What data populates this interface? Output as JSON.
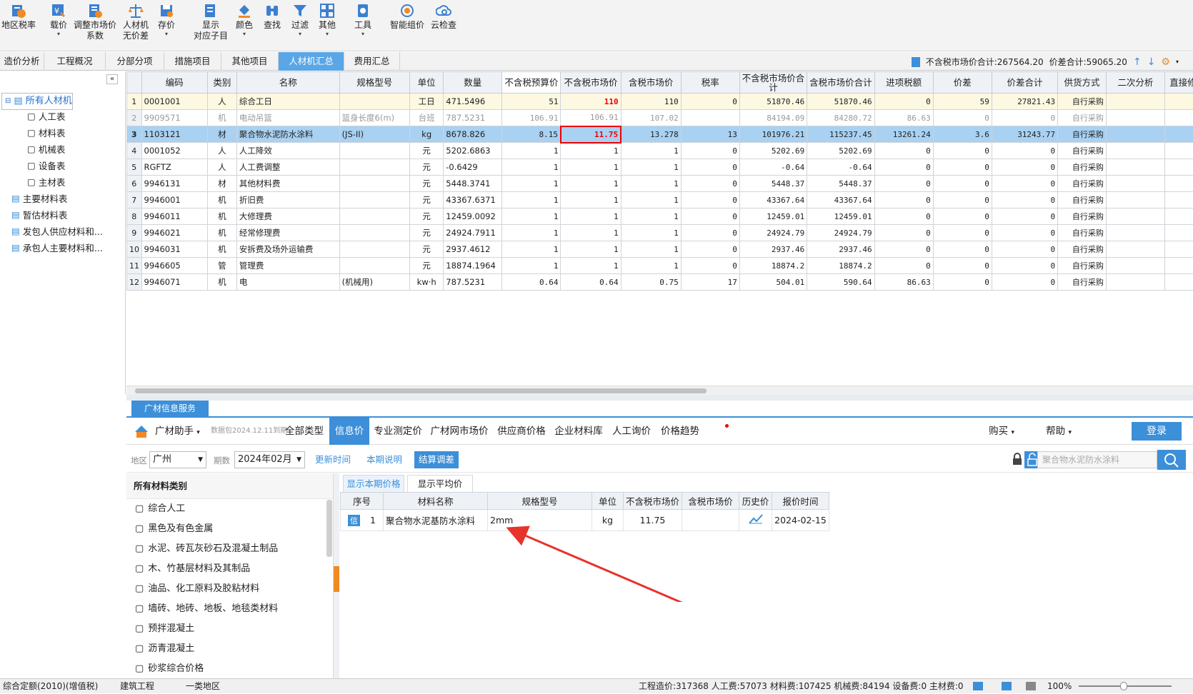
{
  "toolbar": {
    "buttons": [
      {
        "label": "地区税率"
      },
      {
        "label": "载价"
      },
      {
        "label": "调整市场价\n系数"
      },
      {
        "label": "人材机\n无价差"
      },
      {
        "label": "存价"
      },
      {
        "label": "显示\n对应子目"
      },
      {
        "label": "颜色"
      },
      {
        "label": "查找"
      },
      {
        "label": "过滤"
      },
      {
        "label": "其他"
      },
      {
        "label": "工具"
      },
      {
        "label": "智能组价"
      },
      {
        "label": "云检查"
      }
    ]
  },
  "tabs": [
    "造价分析",
    "工程概况",
    "分部分项",
    "措施项目",
    "其他项目",
    "人材机汇总",
    "费用汇总"
  ],
  "tab_info": {
    "tax_free_total": "不含税市场价合计:267564.20",
    "diff_total": "价差合计:59065.20"
  },
  "sidebar": {
    "collapse": "«",
    "items": [
      "所有人材机",
      "人工表",
      "材料表",
      "机械表",
      "设备表",
      "主材表",
      "主要材料表",
      "暂估材料表",
      "发包人供应材料和...",
      "承包人主要材料和..."
    ]
  },
  "grid": {
    "columns": [
      "编码",
      "类别",
      "名称",
      "规格型号",
      "单位",
      "数量",
      "不含税预算价",
      "不含税市场价",
      "含税市场价",
      "税率",
      "不含税市场价合计",
      "含税市场价合计",
      "进项税额",
      "价差",
      "价差合计",
      "供货方式",
      "二次分析",
      "直接修改单"
    ],
    "rows": [
      [
        "1",
        "0001001",
        "人",
        "综合工日",
        "",
        "工日",
        "471.5496",
        "51",
        "110",
        "110",
        "0",
        "51870.46",
        "51870.46",
        "0",
        "59",
        "27821.43",
        "自行采购",
        "",
        ""
      ],
      [
        "2",
        "9909571",
        "机",
        "电动吊篮",
        "篮身长度6(m)",
        "台班",
        "787.5231",
        "106.91",
        "106.91",
        "107.02",
        "",
        "84194.09",
        "84280.72",
        "86.63",
        "0",
        "0",
        "自行采购",
        "",
        ""
      ],
      [
        "3",
        "1103121",
        "材",
        "聚合物水泥防水涂料",
        "(JS-II)",
        "kg",
        "8678.826",
        "8.15",
        "11.75",
        "13.278",
        "13",
        "101976.21",
        "115237.45",
        "13261.24",
        "3.6",
        "31243.77",
        "自行采购",
        "",
        ""
      ],
      [
        "4",
        "0001052",
        "人",
        "人工降效",
        "",
        "元",
        "5202.6863",
        "1",
        "1",
        "1",
        "0",
        "5202.69",
        "5202.69",
        "0",
        "0",
        "0",
        "自行采购",
        "",
        ""
      ],
      [
        "5",
        "RGFTZ",
        "人",
        "人工费调整",
        "",
        "元",
        "-0.6429",
        "1",
        "1",
        "1",
        "0",
        "-0.64",
        "-0.64",
        "0",
        "0",
        "0",
        "自行采购",
        "",
        ""
      ],
      [
        "6",
        "9946131",
        "材",
        "其他材料费",
        "",
        "元",
        "5448.3741",
        "1",
        "1",
        "1",
        "0",
        "5448.37",
        "5448.37",
        "0",
        "0",
        "0",
        "自行采购",
        "",
        ""
      ],
      [
        "7",
        "9946001",
        "机",
        "折旧费",
        "",
        "元",
        "43367.6371",
        "1",
        "1",
        "1",
        "0",
        "43367.64",
        "43367.64",
        "0",
        "0",
        "0",
        "自行采购",
        "",
        ""
      ],
      [
        "8",
        "9946011",
        "机",
        "大修理费",
        "",
        "元",
        "12459.0092",
        "1",
        "1",
        "1",
        "0",
        "12459.01",
        "12459.01",
        "0",
        "0",
        "0",
        "自行采购",
        "",
        ""
      ],
      [
        "9",
        "9946021",
        "机",
        "经常修理费",
        "",
        "元",
        "24924.7911",
        "1",
        "1",
        "1",
        "0",
        "24924.79",
        "24924.79",
        "0",
        "0",
        "0",
        "自行采购",
        "",
        ""
      ],
      [
        "10",
        "9946031",
        "机",
        "安拆费及场外运输费",
        "",
        "元",
        "2937.4612",
        "1",
        "1",
        "1",
        "0",
        "2937.46",
        "2937.46",
        "0",
        "0",
        "0",
        "自行采购",
        "",
        ""
      ],
      [
        "11",
        "9946605",
        "管",
        "管理费",
        "",
        "元",
        "18874.1964",
        "1",
        "1",
        "1",
        "0",
        "18874.2",
        "18874.2",
        "0",
        "0",
        "0",
        "自行采购",
        "",
        ""
      ],
      [
        "12",
        "9946071",
        "机",
        "电",
        "(机械用)",
        "kw·h",
        "787.5231",
        "0.64",
        "0.64",
        "0.75",
        "17",
        "504.01",
        "590.64",
        "86.63",
        "0",
        "0",
        "自行采购",
        "",
        ""
      ]
    ]
  },
  "info_service": {
    "tab": "广材信息服务",
    "assistant": "广材助手",
    "data_pkg": "数据包2024.12.11到期",
    "nav": [
      "全部类型",
      "信息价",
      "专业测定价",
      "广材网市场价",
      "供应商价格",
      "企业材料库",
      "人工询价",
      "价格趋势"
    ],
    "buy": "购买",
    "help": "帮助",
    "login": "登录",
    "region_label": "地区",
    "region": "广州",
    "period_label": "期数",
    "period": "2024年02月",
    "update_time": "更新时间",
    "period_note": "本期说明",
    "settle": "结算调差",
    "search_placeholder": "聚合物水泥防水涂料",
    "cat_title": "所有材料类别",
    "categories": [
      "综合人工",
      "黑色及有色金属",
      "水泥、砖瓦灰砂石及混凝土制品",
      "木、竹基层材料及其制品",
      "油品、化工原料及胶粘材料",
      "墙砖、地砖、地板、地毯类材料",
      "预拌混凝土",
      "沥青混凝土",
      "砂浆综合价格"
    ],
    "price_tabs": [
      "显示本期价格",
      "显示平均价"
    ],
    "price_columns": [
      "序号",
      "材料名称",
      "规格型号",
      "单位",
      "不含税市场价",
      "含税市场价",
      "历史价",
      "报价时间"
    ],
    "price_rows": [
      {
        "badge": "信",
        "idx": "1",
        "name": "聚合物水泥基防水涂料",
        "spec": "2mm",
        "unit": "kg",
        "price_ex": "11.75",
        "price_in": "",
        "date": "2024-02-15"
      }
    ]
  },
  "status": {
    "quota": "综合定额(2010)(增值税)",
    "type": "建筑工程",
    "region": "一类地区",
    "totals": "工程造价:317368  人工费:57073  材料费:107425  机械费:84194  设备费:0  主材费:0",
    "zoom": "100%"
  },
  "colors": {
    "accent": "#3c8fd8",
    "highlight_red": "#e00000",
    "selected_row": "#a9d1f2"
  }
}
